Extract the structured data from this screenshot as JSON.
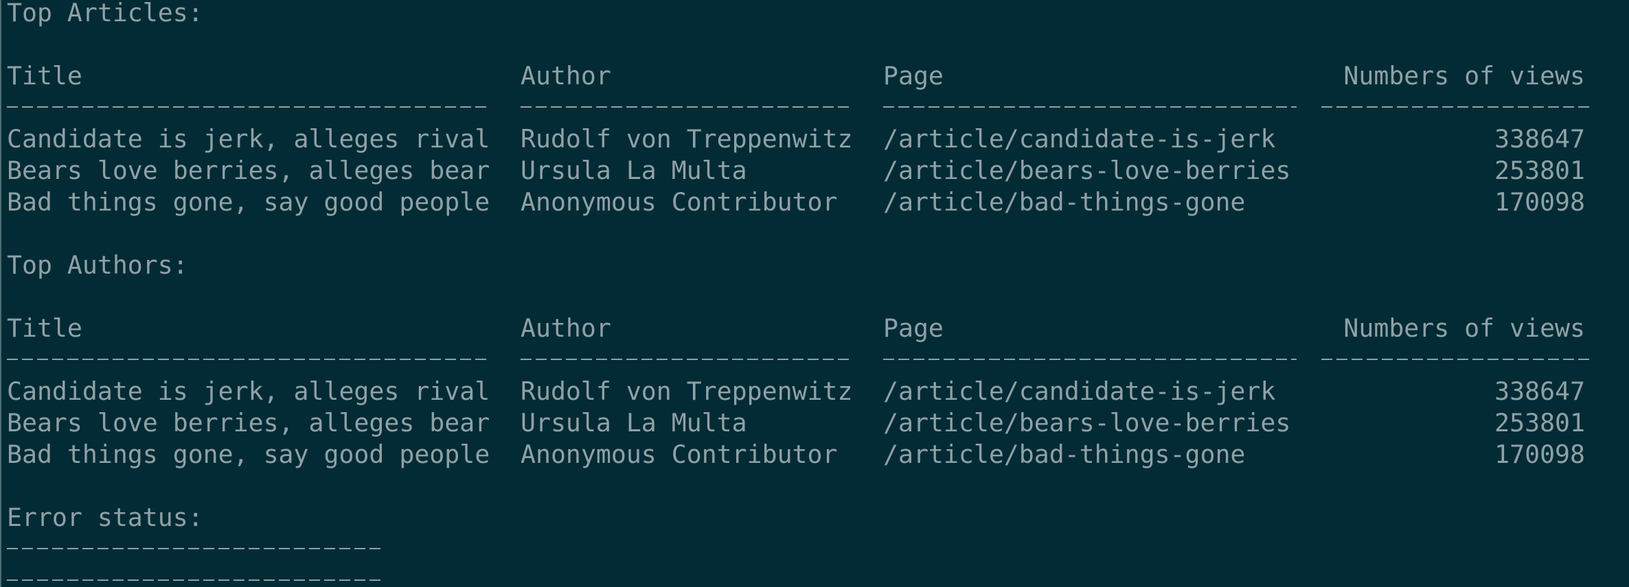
{
  "sections": {
    "top_articles": {
      "heading": "Top Articles:",
      "columns": {
        "title": "Title",
        "author": "Author",
        "page": "Page",
        "views": "Numbers of views"
      },
      "rows": [
        {
          "title": "Candidate is jerk, alleges rival",
          "author": "Rudolf von Treppenwitz",
          "page": "/article/candidate-is-jerk",
          "views": "338647"
        },
        {
          "title": "Bears love berries, alleges bear",
          "author": "Ursula La Multa",
          "page": "/article/bears-love-berries",
          "views": "253801"
        },
        {
          "title": "Bad things gone, say good people",
          "author": "Anonymous Contributor",
          "page": "/article/bad-things-gone",
          "views": "170098"
        }
      ]
    },
    "top_authors": {
      "heading": "Top Authors:",
      "columns": {
        "title": "Title",
        "author": "Author",
        "page": "Page",
        "views": "Numbers of views"
      },
      "rows": [
        {
          "title": "Candidate is jerk, alleges rival",
          "author": "Rudolf von Treppenwitz",
          "page": "/article/candidate-is-jerk",
          "views": "338647"
        },
        {
          "title": "Bears love berries, alleges bear",
          "author": "Ursula La Multa",
          "page": "/article/bears-love-berries",
          "views": "253801"
        },
        {
          "title": "Bad things gone, say good people",
          "author": "Anonymous Contributor",
          "page": "/article/bad-things-gone",
          "views": "170098"
        }
      ]
    },
    "error_status": {
      "heading": "Error status:"
    }
  },
  "colors": {
    "background": "#032b35",
    "text": "#8fa1a6",
    "border": "#4f6c73"
  }
}
